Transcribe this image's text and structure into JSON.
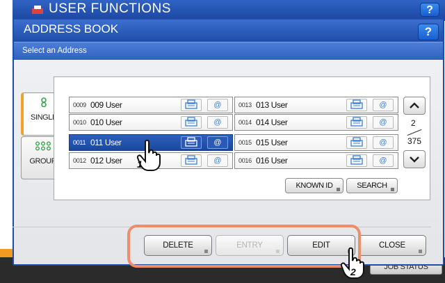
{
  "background_window": {
    "title": "USER FUNCTIONS",
    "help_label": "?",
    "job_status_label": "JOB STATUS"
  },
  "dialog": {
    "title": "ADDRESS BOOK",
    "help_label": "?",
    "subtitle": "Select an Address"
  },
  "tabs": [
    {
      "label": "SINGLE",
      "icon": "single-user-icon",
      "active": true
    },
    {
      "label": "GROUP",
      "icon": "group-icon",
      "active": false
    }
  ],
  "entries_left": [
    {
      "number": "0009",
      "name": "009 User",
      "selected": false
    },
    {
      "number": "0010",
      "name": "010 User",
      "selected": false
    },
    {
      "number": "0011",
      "name": "011 User",
      "selected": true
    },
    {
      "number": "0012",
      "name": "012 User",
      "selected": false
    }
  ],
  "entries_right": [
    {
      "number": "0013",
      "name": "013 User",
      "selected": false
    },
    {
      "number": "0014",
      "name": "014 User",
      "selected": false
    },
    {
      "number": "0015",
      "name": "015 User",
      "selected": false
    },
    {
      "number": "0016",
      "name": "016 User",
      "selected": false
    }
  ],
  "entry_icons": {
    "fax": "fax-icon",
    "email": "email-icon",
    "email_glyph": "@"
  },
  "pagination": {
    "current": "2",
    "total": "375"
  },
  "search_buttons": {
    "known_id": "KNOWN ID",
    "search": "SEARCH"
  },
  "bottom_buttons": {
    "delete": "DELETE",
    "entry": "ENTRY",
    "edit": "EDIT",
    "close": "CLOSE"
  },
  "callouts": {
    "step1": "1",
    "step2": "2"
  },
  "colors": {
    "accent_blue": "#1e4da8",
    "selected_row": "#2458b5",
    "highlight_ring": "#ec8e6a",
    "active_tab_marker": "#f0a22a"
  }
}
